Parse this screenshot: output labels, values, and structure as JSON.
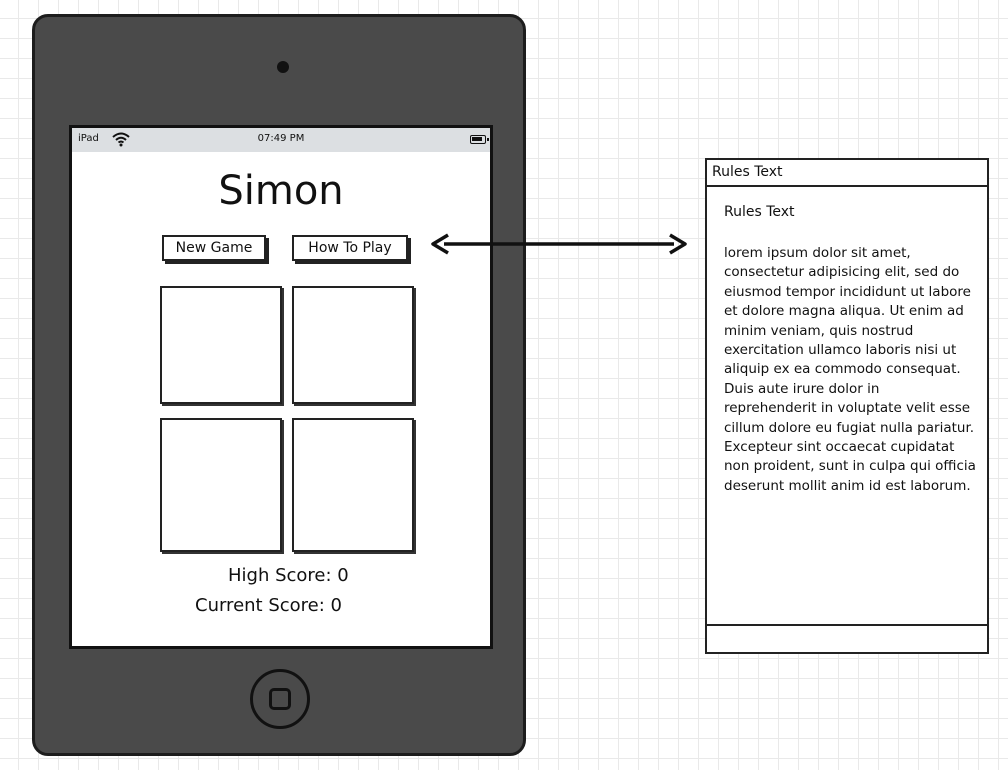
{
  "device": {
    "status_bar": {
      "carrier": "iPad",
      "time": "07:49 PM",
      "wifi_icon": "wifi-icon",
      "battery_icon": "battery-icon"
    },
    "app": {
      "title": "Simon",
      "new_game_label": "New Game",
      "how_to_play_label": "How To Play",
      "high_score_text": "High Score: 0",
      "current_score_text": "Current Score: 0"
    }
  },
  "rules_panel": {
    "header": "Rules Text",
    "subtitle": "Rules Text",
    "body": "lorem ipsum dolor sit amet, consectetur adipisicing elit, sed do eiusmod tempor incididunt ut labore et dolore magna aliqua. Ut enim ad minim veniam, quis nostrud exercitation ullamco laboris nisi ut aliquip ex ea commodo consequat. Duis aute irure dolor in reprehenderit in voluptate velit esse cillum dolore eu fugiat nulla pariatur. Excepteur sint occaecat cupidatat non proident, sunt in culpa qui officia deserunt mollit anim id est laborum."
  },
  "colors": {
    "device_body": "#4a4a4a",
    "status_bar": "#dcdfe2",
    "ink": "#111111"
  }
}
